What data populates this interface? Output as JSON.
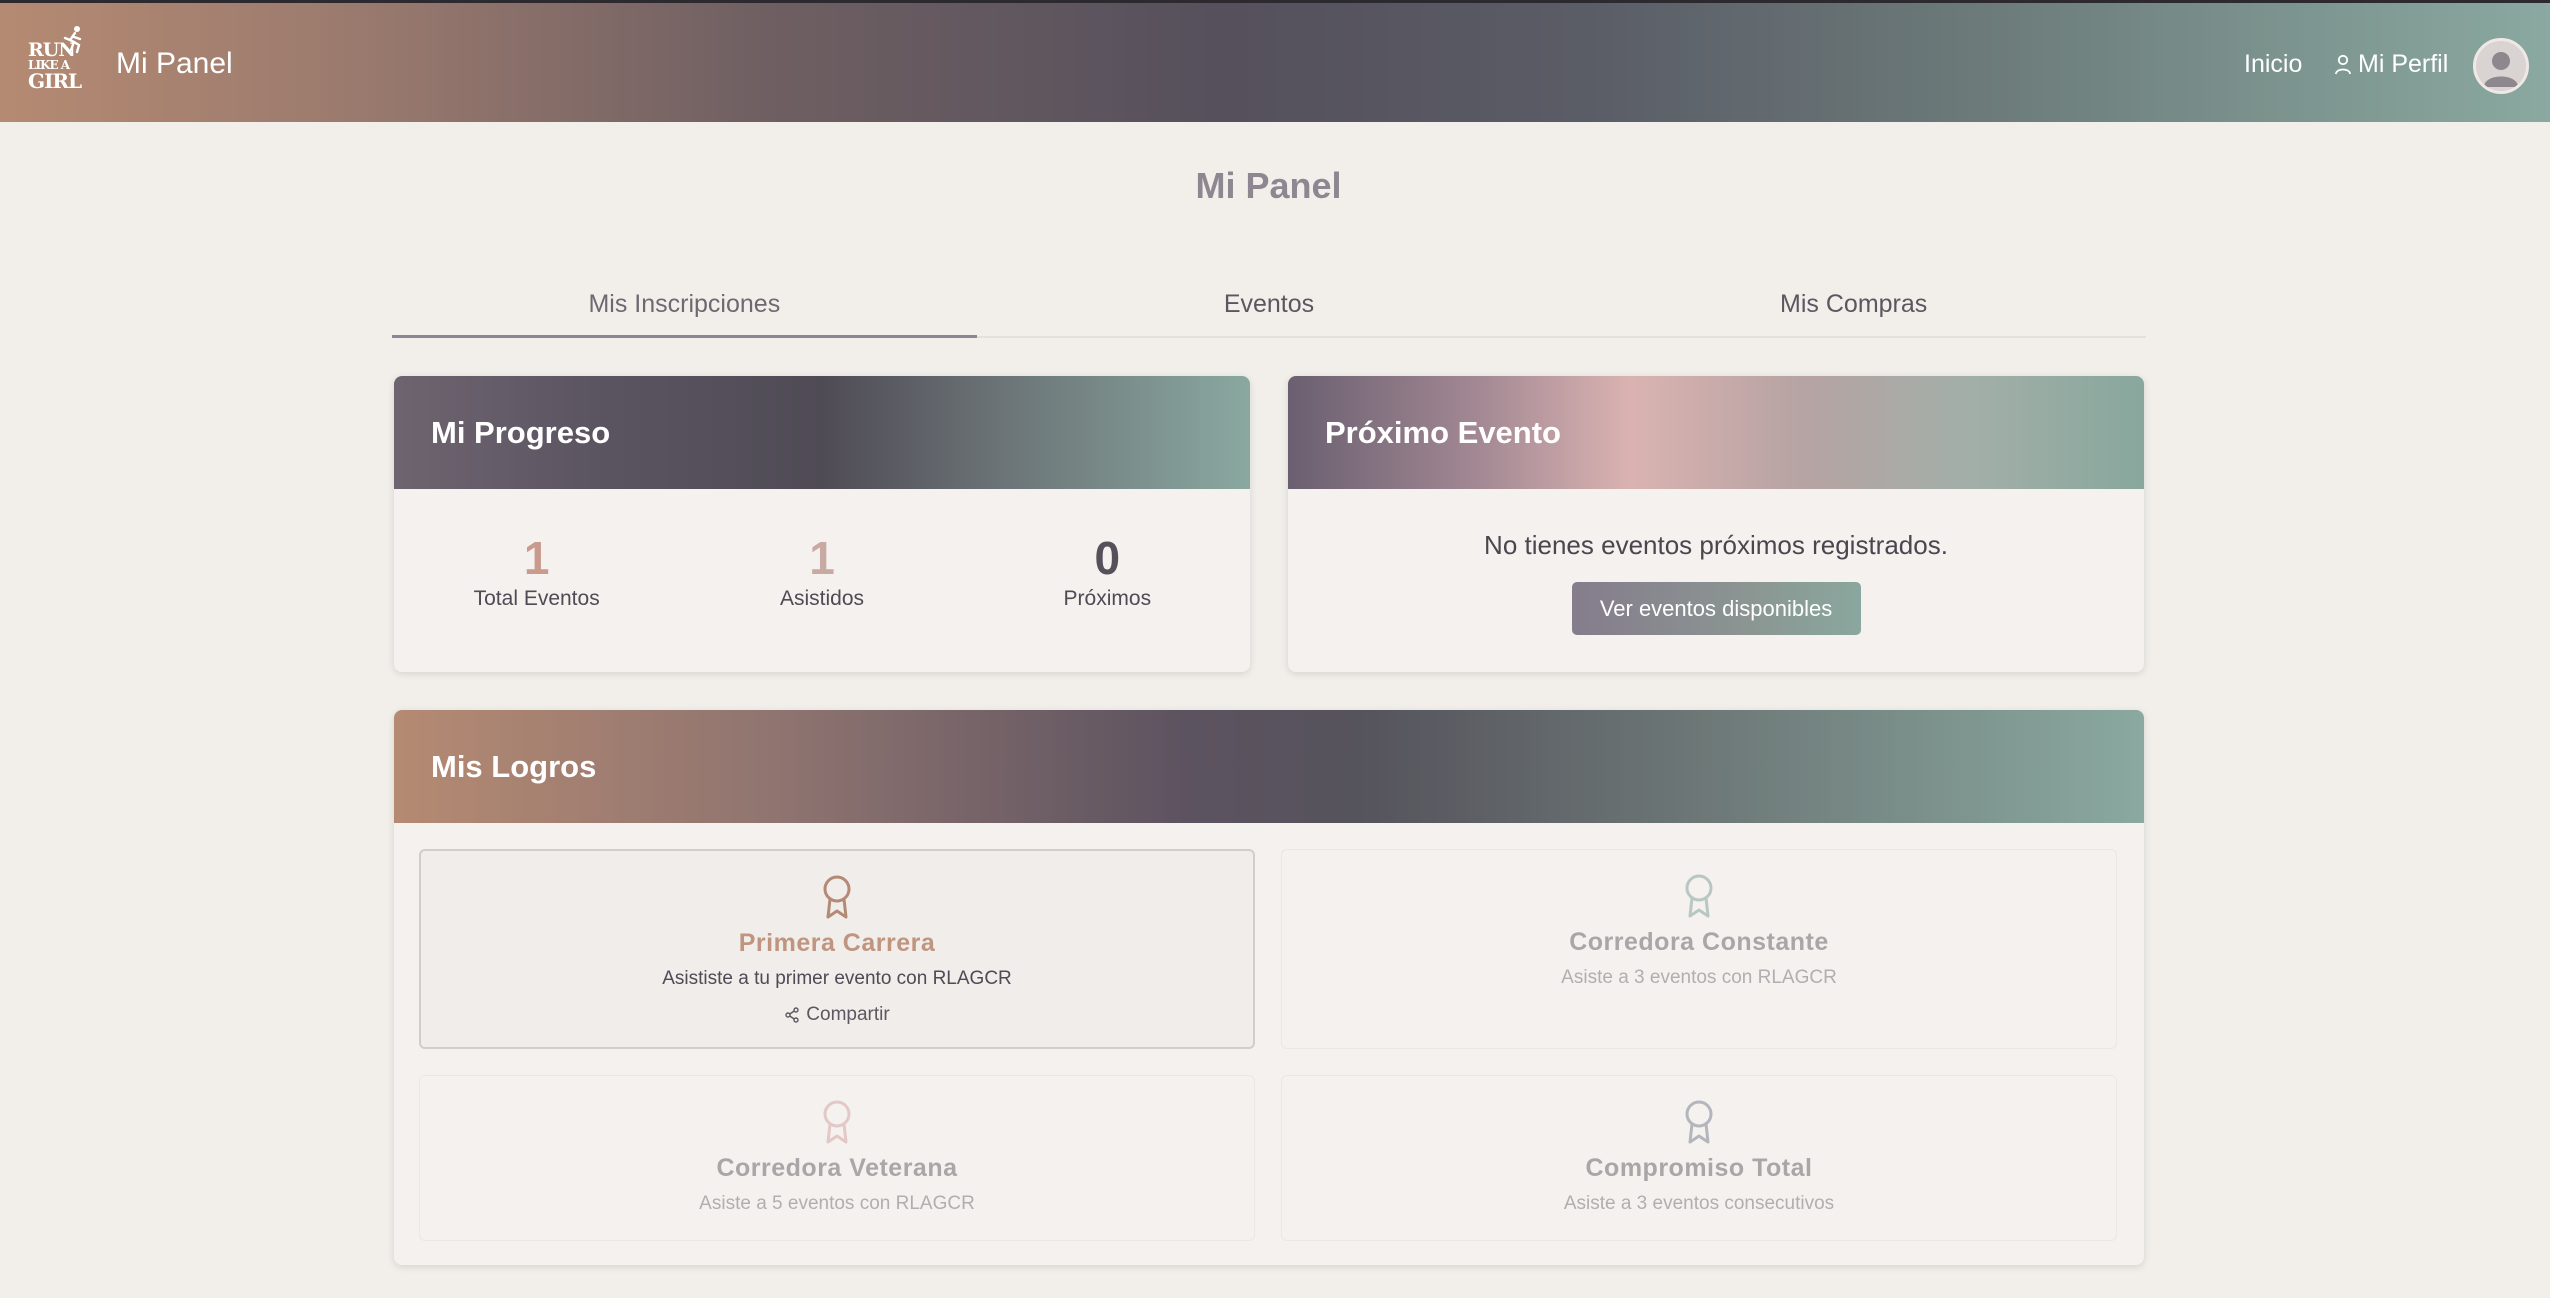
{
  "header": {
    "logo_lines": [
      "RUN",
      "LIKE A",
      "GIRL"
    ],
    "title": "Mi Panel",
    "nav": {
      "inicio": "Inicio",
      "perfil": "Mi Perfil"
    }
  },
  "page": {
    "title": "Mi Panel"
  },
  "tabs": [
    {
      "label": "Mis Inscripciones",
      "active": true
    },
    {
      "label": "Eventos",
      "active": false
    },
    {
      "label": "Mis Compras",
      "active": false
    }
  ],
  "progress": {
    "title": "Mi Progreso",
    "stats": [
      {
        "value": "1",
        "label": "Total Eventos",
        "color": "#c99b8c"
      },
      {
        "value": "1",
        "label": "Asistidos",
        "color": "#c8aaa2"
      },
      {
        "value": "0",
        "label": "Próximos",
        "color": "#55505a"
      }
    ]
  },
  "next_event": {
    "title": "Próximo Evento",
    "message": "No tienes eventos próximos registrados.",
    "button": "Ver eventos disponibles"
  },
  "achievements": {
    "title": "Mis Logros",
    "items": [
      {
        "title": "Primera Carrera",
        "desc": "Asististe a tu primer evento con RLAGCR",
        "share": "Compartir",
        "earned": true,
        "icon_color": "#b48a76"
      },
      {
        "title": "Corredora Constante",
        "desc": "Asiste a 3 eventos con RLAGCR",
        "earned": false,
        "icon_color": "#b9c7c3"
      },
      {
        "title": "Corredora Veterana",
        "desc": "Asiste a 5 eventos con RLAGCR",
        "earned": false,
        "icon_color": "#e3c8c6"
      },
      {
        "title": "Compromiso Total",
        "desc": "Asiste a 3 eventos consecutivos",
        "earned": false,
        "icon_color": "#b3b6bc"
      }
    ]
  },
  "icons": [
    "runner-logo-icon",
    "user-icon",
    "avatar-icon",
    "award-icon",
    "share-icon"
  ]
}
